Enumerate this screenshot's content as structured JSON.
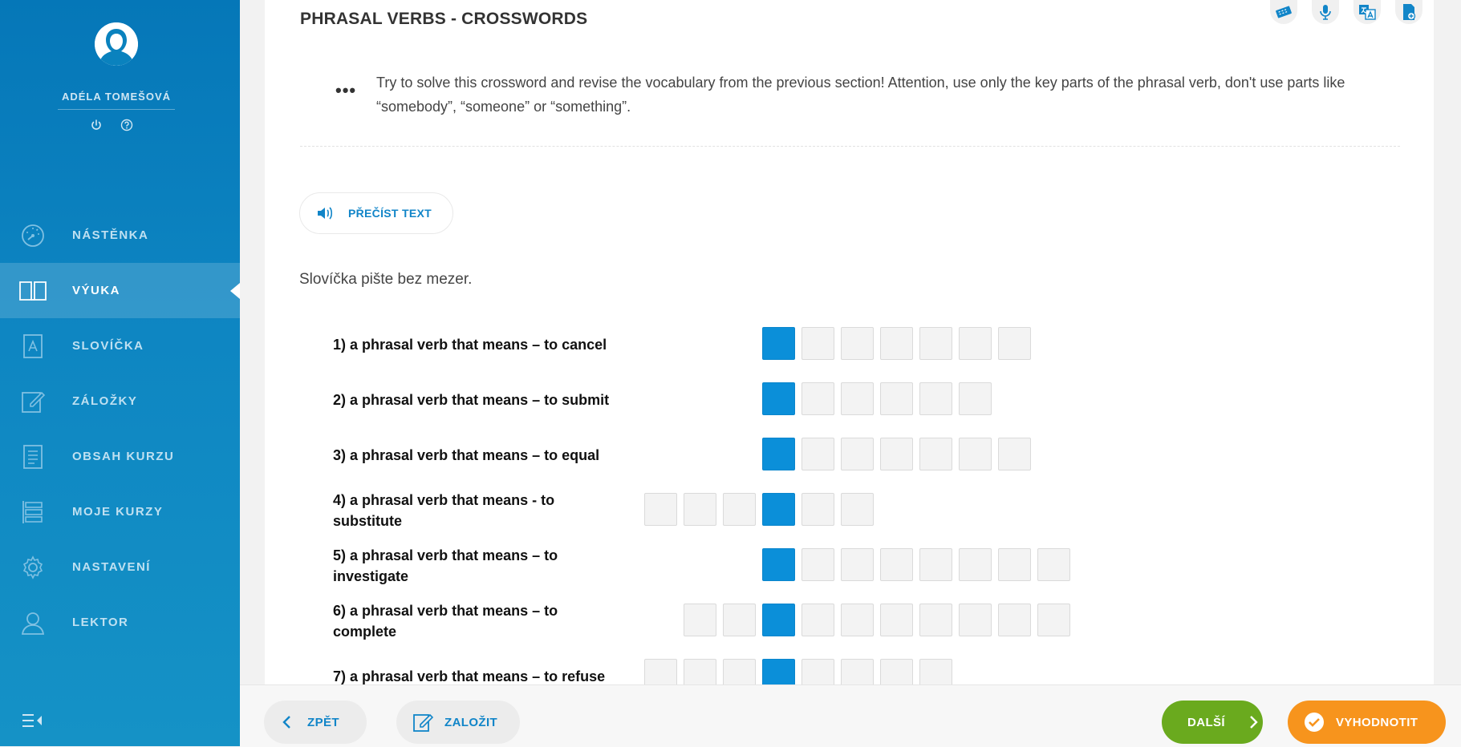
{
  "user": {
    "name": "ADÉLA TOMEŠOVÁ"
  },
  "sidebar": {
    "items": [
      {
        "label": "NÁSTĚNKA",
        "icon": "dashboard-gauge-icon"
      },
      {
        "label": "VÝUKA",
        "icon": "open-book-icon",
        "active": true
      },
      {
        "label": "SLOVÍČKA",
        "icon": "vocabulary-book-icon"
      },
      {
        "label": "ZÁLOŽKY",
        "icon": "edit-note-icon"
      },
      {
        "label": "OBSAH KURZU",
        "icon": "document-list-icon"
      },
      {
        "label": "MOJE KURZY",
        "icon": "courses-list-icon"
      },
      {
        "label": "NASTAVENÍ",
        "icon": "gear-icon"
      },
      {
        "label": "LEKTOR",
        "icon": "person-icon"
      }
    ]
  },
  "main": {
    "title": "PHRASAL VERBS - CROSSWORDS",
    "instruction_marker": "•••",
    "instruction": "Try to solve this crossword and revise the vocabulary from the previous section! Attention, use only the key parts of the phrasal verb, don't use parts like “somebody”, “someone” or “something”.",
    "read_button": "PŘEČÍST TEXT",
    "hint": "Slovíčka pište bez mezer.",
    "clues": [
      {
        "text": "1) a phrasal verb that means – to cancel",
        "before": 0,
        "after": 6
      },
      {
        "text": "2) a phrasal verb that means – to submit",
        "before": 0,
        "after": 5
      },
      {
        "text": "3) a phrasal verb that means – to equal",
        "before": 0,
        "after": 6
      },
      {
        "text": "4) a phrasal verb that means - to substitute",
        "before": 3,
        "after": 2
      },
      {
        "text": "5) a phrasal verb that means – to investigate",
        "before": 0,
        "after": 7
      },
      {
        "text": "6) a phrasal verb that means – to complete",
        "before": 2,
        "after": 7
      },
      {
        "text": "7) a phrasal verb that means – to refuse",
        "before": 3,
        "after": 4
      }
    ]
  },
  "toolbar": {
    "icons": [
      "keyboard-icon",
      "microphone-icon",
      "translate-icon",
      "add-document-icon"
    ]
  },
  "bottom": {
    "back": "ZPĚT",
    "bookmark": "ZALOŽIT",
    "next": "DALŠÍ",
    "evaluate": "VYHODNOTIT"
  },
  "colors": {
    "sidebar": "#0a82be",
    "key_cell": "#0b8fd9",
    "accent": "#1185c8",
    "next": "#6aaa1e",
    "evaluate": "#f7941d"
  }
}
